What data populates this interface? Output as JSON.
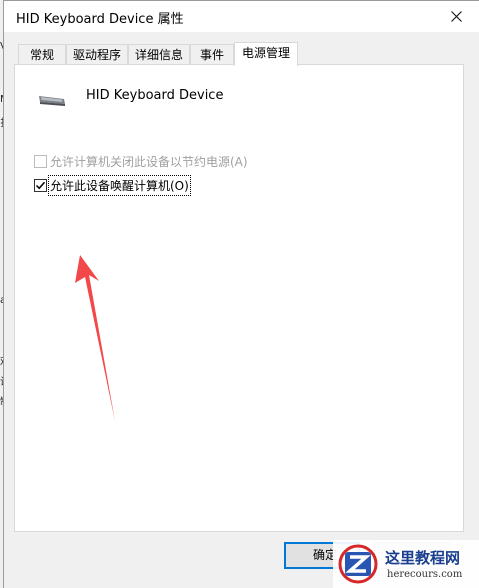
{
  "window": {
    "title": "HID Keyboard Device 属性"
  },
  "tabs": [
    {
      "label": "常规",
      "active": false
    },
    {
      "label": "驱动程序",
      "active": false
    },
    {
      "label": "详细信息",
      "active": false
    },
    {
      "label": "事件",
      "active": false
    },
    {
      "label": "电源管理",
      "active": true
    }
  ],
  "device": {
    "name": "HID Keyboard Device",
    "icon": "keyboard-icon"
  },
  "power_options": [
    {
      "label": "允许计算机关闭此设备以节约电源(A)",
      "checked": false,
      "enabled": false
    },
    {
      "label": "允许此设备唤醒计算机(O)",
      "checked": true,
      "enabled": true
    }
  ],
  "buttons": {
    "ok": "确定"
  },
  "annotation": {
    "color": "#f2484a"
  },
  "watermark": {
    "text": "这里教程网",
    "url": "herecours.com"
  },
  "edge_fragments": [
    "V",
    "M",
    "扌",
    "ar",
    "戏",
    "设",
    "制"
  ]
}
